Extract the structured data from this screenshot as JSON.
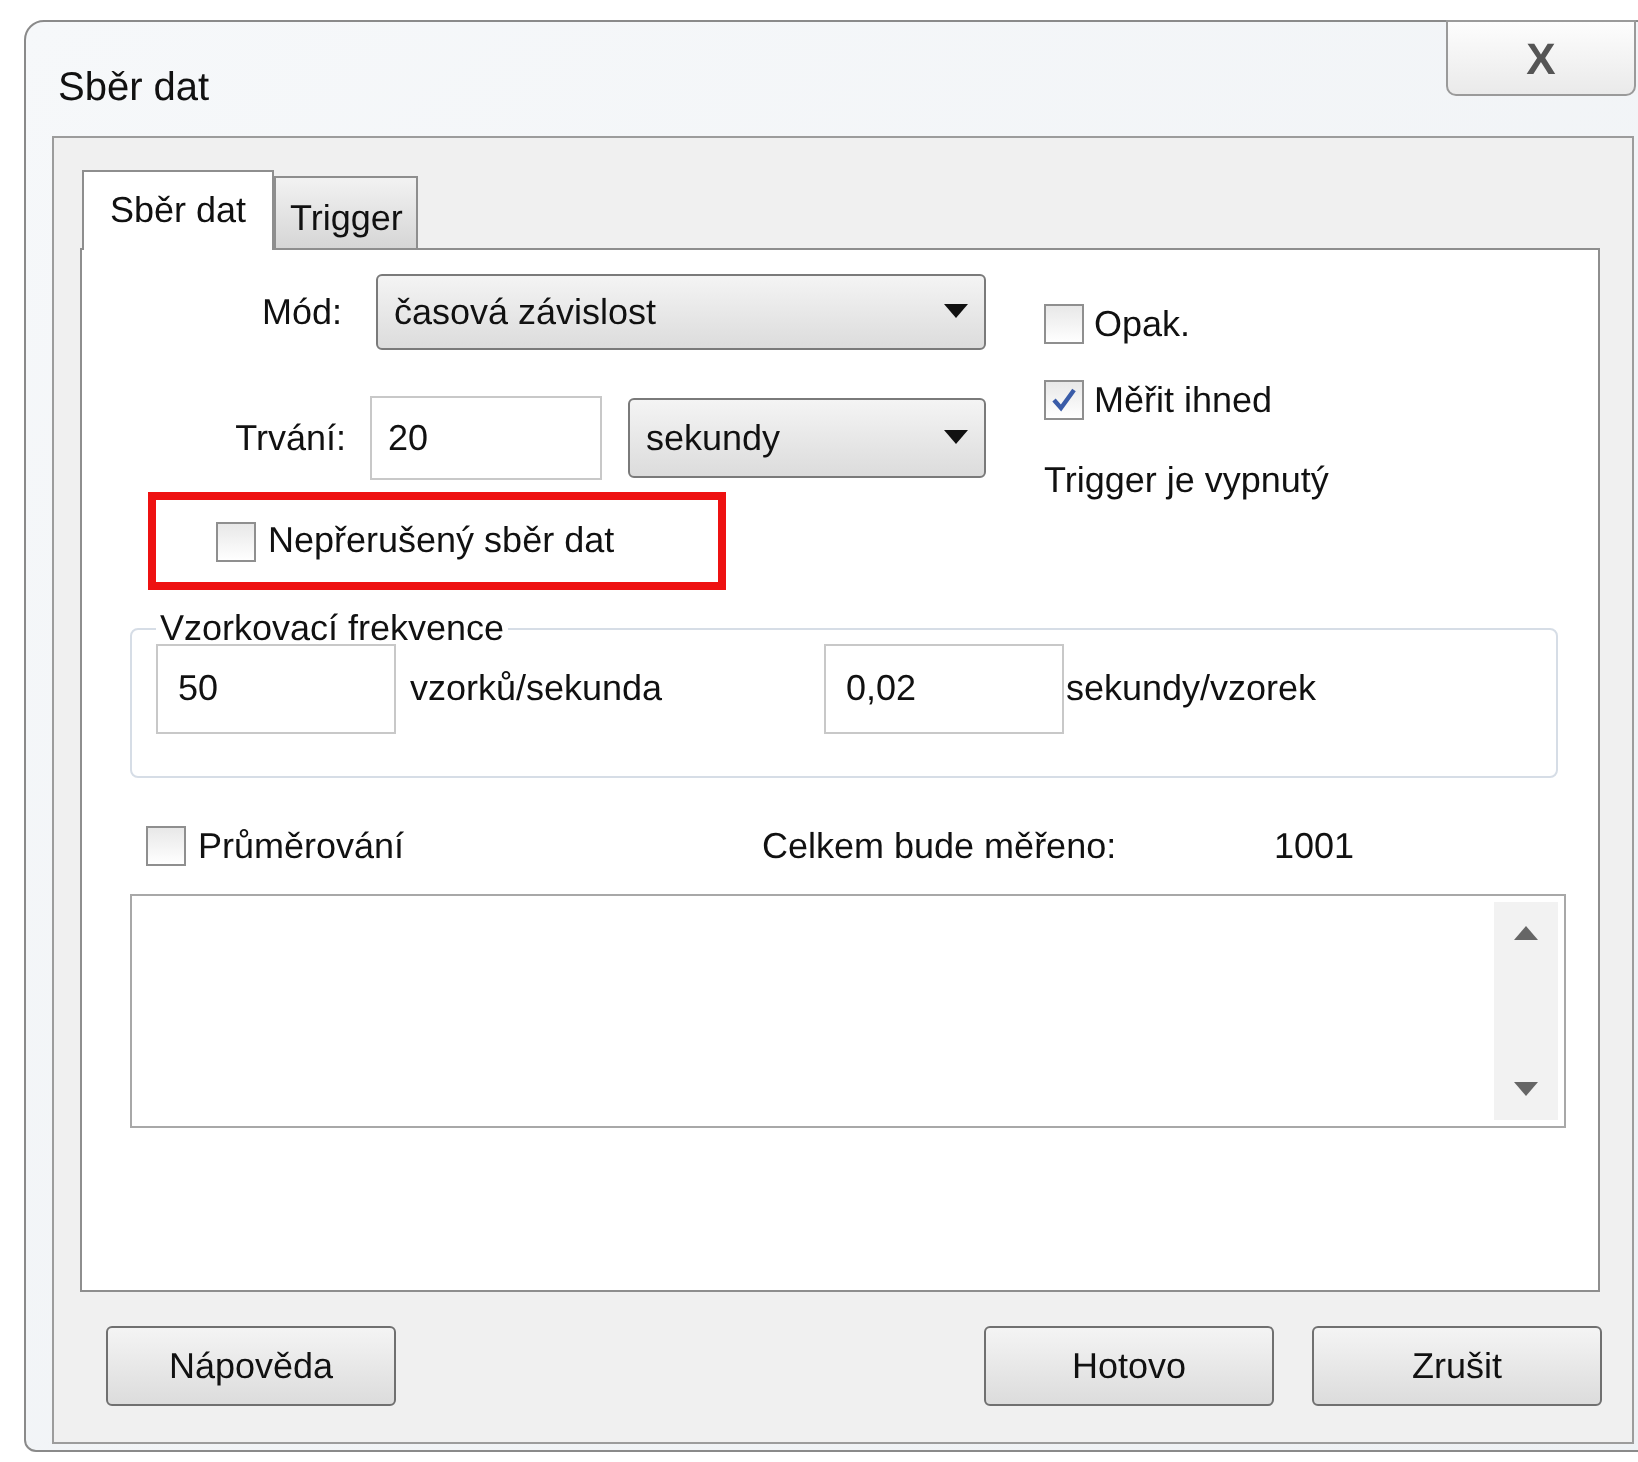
{
  "window": {
    "title": "Sběr dat",
    "close": "X"
  },
  "tabs": [
    {
      "label": "Sběr dat",
      "selected": true
    },
    {
      "label": "Trigger",
      "selected": false
    }
  ],
  "mode": {
    "label": "Mód:",
    "value": "časová závislost"
  },
  "duration": {
    "label": "Trvání:",
    "value": "20",
    "unit": "sekundy"
  },
  "options": [
    {
      "label": "Opak.",
      "checked": false
    },
    {
      "label": "Měřit ihned",
      "checked": true
    }
  ],
  "trigger_status": "Trigger je vypnutý",
  "continuous": {
    "label": "Nepřerušený sběr dat",
    "checked": false,
    "highlighted": true
  },
  "sampling": {
    "title": "Vzorkovací frekvence",
    "rate": "50",
    "rate_unit": "vzorků/sekunda",
    "period": "0,02",
    "period_unit": "sekundy/vzorek"
  },
  "averaging": {
    "label": "Průměrování",
    "checked": false
  },
  "total": {
    "label": "Celkem bude měřeno:",
    "value": "1001"
  },
  "buttons": [
    "Nápověda",
    "Hotovo",
    "Zrušit"
  ]
}
